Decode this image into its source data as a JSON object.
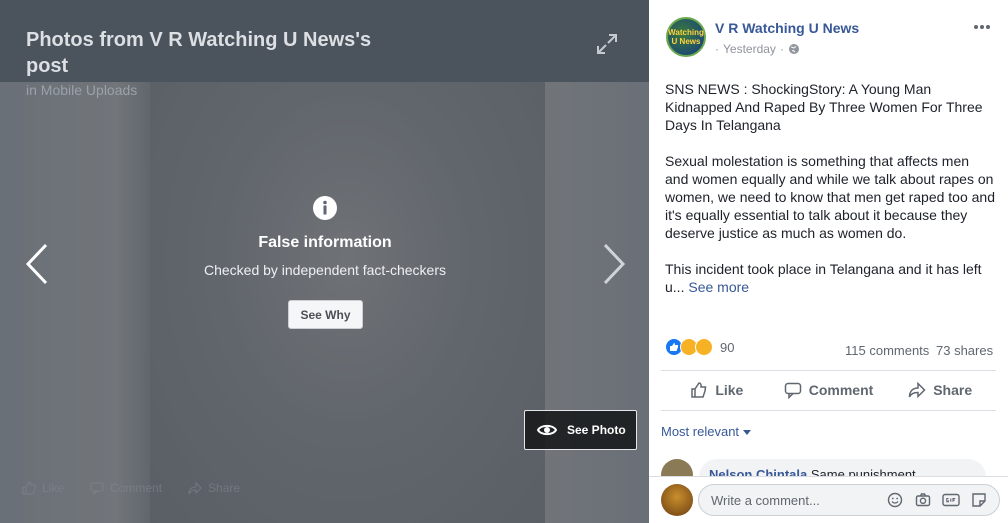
{
  "viewer": {
    "title": "Photos from V R Watching U News's post",
    "subtitle": "in Mobile Uploads",
    "fact_check": {
      "title": "False information",
      "subtitle": "Checked by independent fact-checkers",
      "see_why_label": "See Why",
      "see_photo_label": "See Photo"
    },
    "actions": [
      "Like",
      "Comment",
      "Share"
    ]
  },
  "post": {
    "page_name": "V R Watching U News",
    "avatar_text": "Watching U News",
    "timestamp": "Yesterday",
    "separator": "·",
    "headline": "SNS NEWS : ShockingStory: A Young Man Kidnapped And Raped By Three Women For Three Days In Telangana",
    "paragraph_1": "Sexual molestation is something that affects men and women equally and while we talk about rapes on women, we need to know that men get raped too and it's equally essential to talk about it because they deserve justice as much as women do.",
    "paragraph_2": "This incident took place in Telangana and it has left u...",
    "see_more": "See more",
    "reaction_count": "90",
    "comments_count": "115 comments",
    "shares_count": "73 shares",
    "actions": {
      "like": "Like",
      "comment": "Comment",
      "share": "Share"
    },
    "sort_label": "Most relevant",
    "comment_preview": {
      "author": "Nelson Chintala",
      "text": "Same punishment"
    },
    "comment_placeholder": "Write a comment..."
  },
  "icons": {
    "expand": "expand-icon",
    "prev": "chevron-left-icon",
    "next": "chevron-right-icon",
    "info": "info-icon",
    "eye": "eye-icon",
    "globe": "globe-icon",
    "more": "more-icon",
    "reactions": [
      "like-reaction-icon",
      "sad-reaction-icon",
      "wow-reaction-icon"
    ],
    "comment_tools": [
      "emoji-icon",
      "camera-icon",
      "gif-icon",
      "sticker-icon"
    ]
  },
  "colors": {
    "link": "#385898",
    "viewer_bg": "#5e6771",
    "like_blue": "#1877f2"
  }
}
